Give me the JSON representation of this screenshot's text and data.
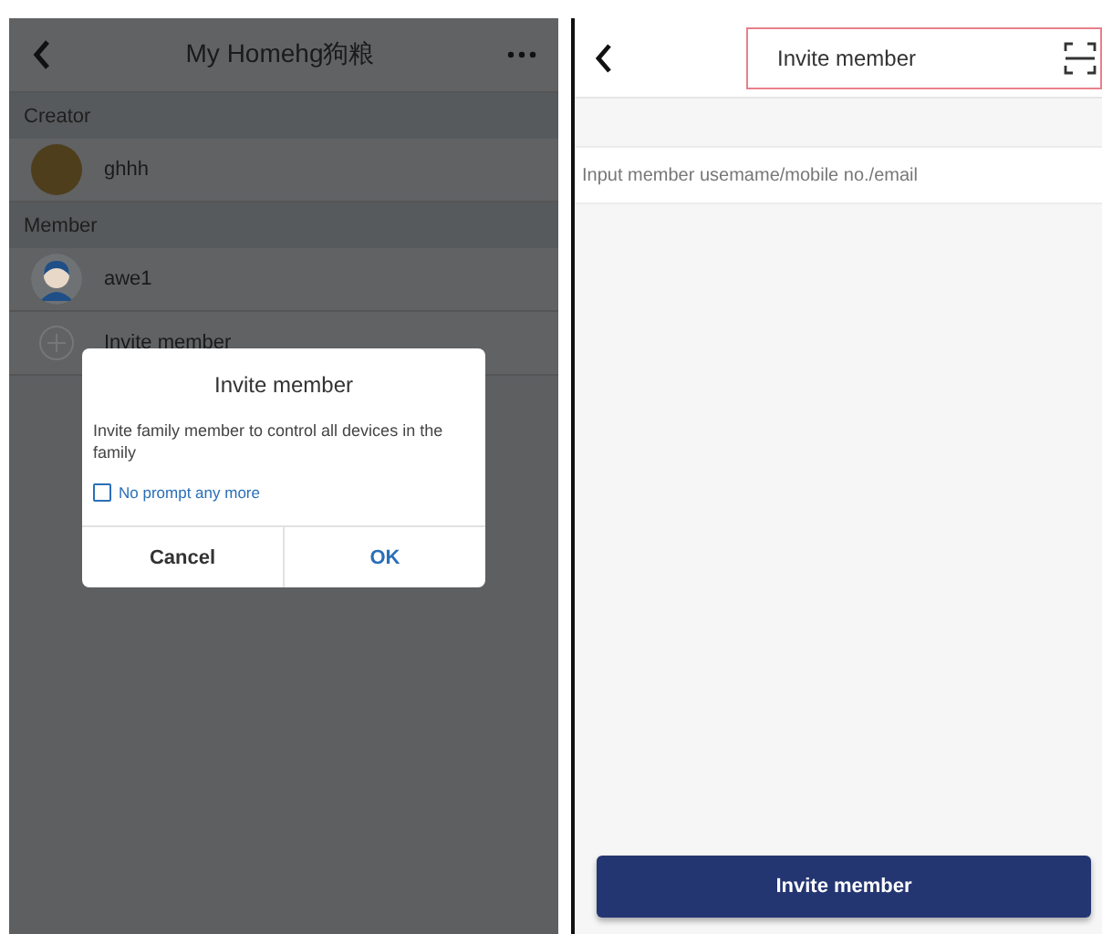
{
  "family_screen": {
    "title": "My Homehg狗粮",
    "sections": [
      {
        "label": "Creator",
        "members": [
          {
            "name": "ghhh",
            "kind": "photo"
          }
        ]
      },
      {
        "label": "Member",
        "members": [
          {
            "name": "awe1",
            "kind": "default"
          }
        ]
      }
    ],
    "invite_row": {
      "label": "Invite member"
    },
    "dialog": {
      "title": "Invite member",
      "message": "Invite family member to control all devices in the family",
      "checkbox": {
        "label": "No prompt any more",
        "checked": false
      },
      "buttons": [
        "Cancel",
        "OK"
      ]
    }
  },
  "invite_screen": {
    "title": "Invite member",
    "highlighted": true,
    "field": {
      "placeholder": "Input member usemame/mobile no./email"
    },
    "button": "Invite member"
  }
}
